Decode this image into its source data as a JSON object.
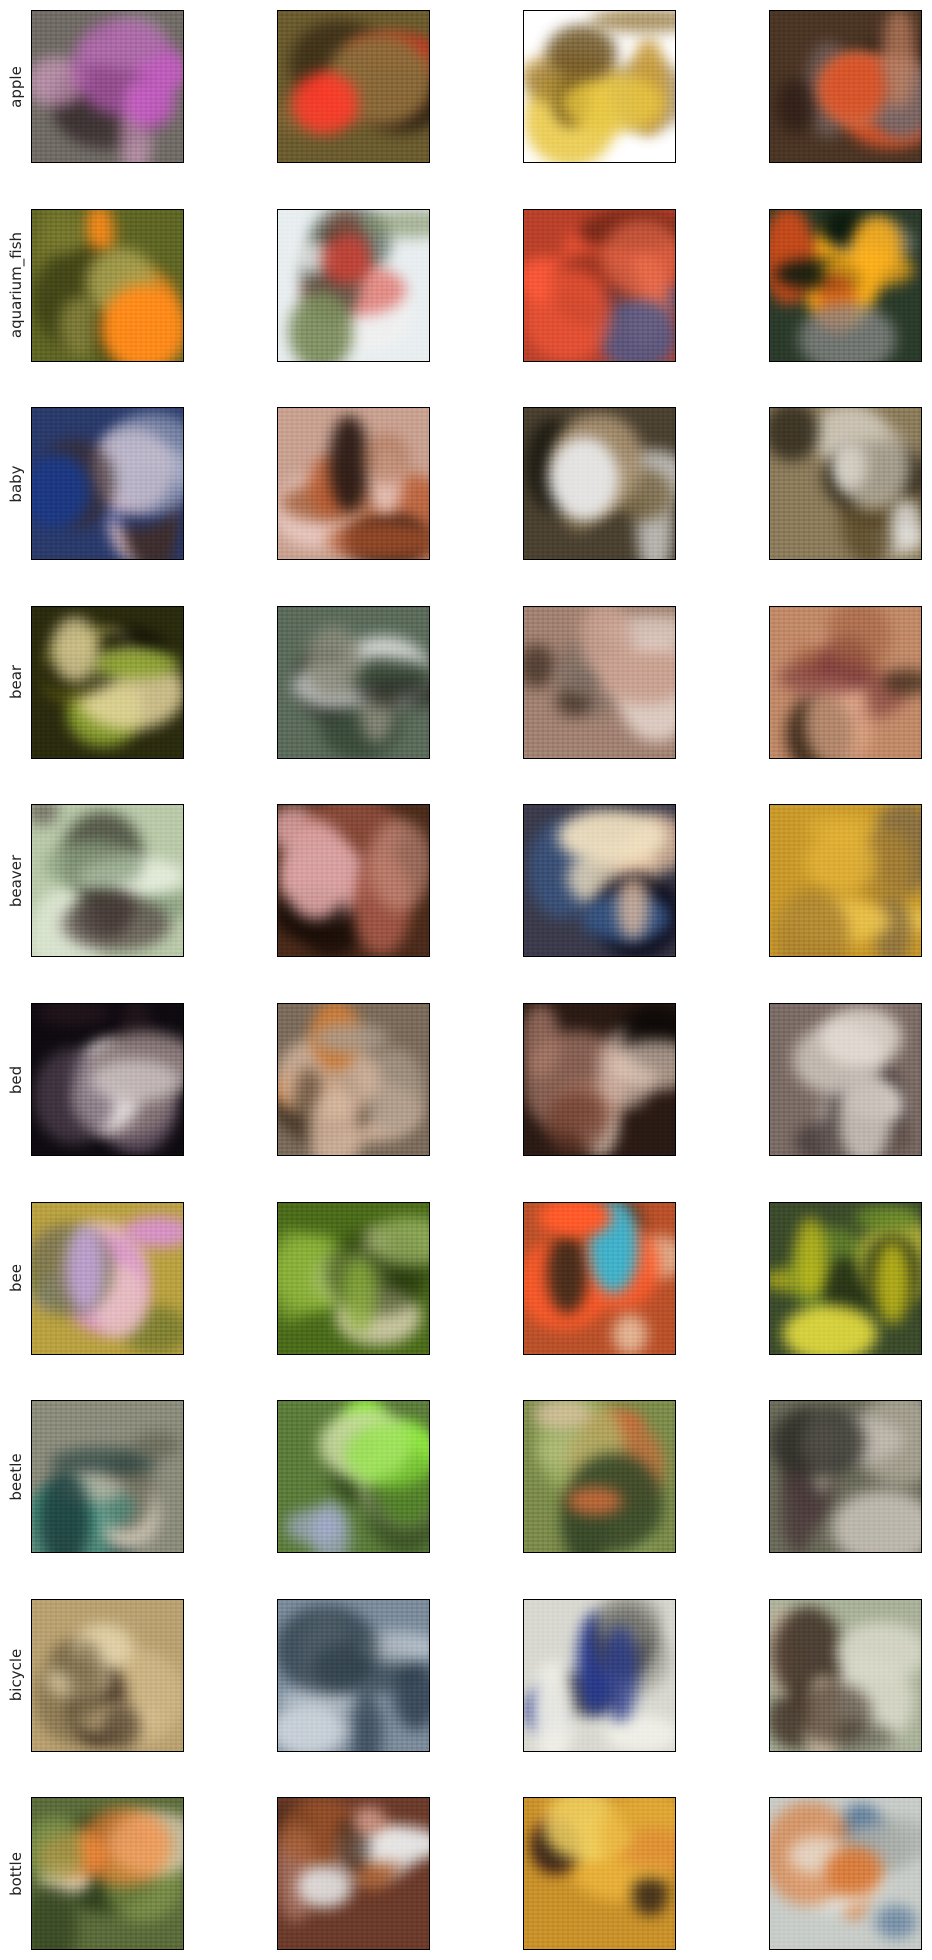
{
  "rows": [
    {
      "label": "apple",
      "tiles": [
        {
          "bg": "#6f6a64",
          "accents": [
            "#c25cc0",
            "#8a8883",
            "#3a2f30",
            "#d9a0c8"
          ]
        },
        {
          "bg": "#6a5a2e",
          "accents": [
            "#ff3b2a",
            "#d82a1a",
            "#2a1e10",
            "#8a6a3a"
          ]
        },
        {
          "bg": "#ffffff",
          "accents": [
            "#8a6a2a",
            "#c79a3a",
            "#e8c640",
            "#6a5020"
          ]
        },
        {
          "bg": "#4a3424",
          "accents": [
            "#d8542a",
            "#7a6a6a",
            "#2a1a14",
            "#c08060"
          ]
        }
      ]
    },
    {
      "label": "aquarium_fish",
      "tiles": [
        {
          "bg": "#5e6424",
          "accents": [
            "#ff8a1a",
            "#7a7a30",
            "#3a3e14",
            "#a8a050"
          ]
        },
        {
          "bg": "#e8eef0",
          "accents": [
            "#d8443a",
            "#2a3a2a",
            "#7a8a5a",
            "#f0f0f0"
          ]
        },
        {
          "bg": "#b8402a",
          "accents": [
            "#ff5a3a",
            "#7a2a1a",
            "#4a5a8a",
            "#e86a4a"
          ]
        },
        {
          "bg": "#2a3a2a",
          "accents": [
            "#ffb01a",
            "#c84a1a",
            "#8a8a8a",
            "#0a1a10"
          ]
        }
      ]
    },
    {
      "label": "baby",
      "tiles": [
        {
          "bg": "#2a3a6a",
          "accents": [
            "#1a3a8a",
            "#e8c8d0",
            "#a8b0c8",
            "#3a2a2a"
          ]
        },
        {
          "bg": "#c8a090",
          "accents": [
            "#b85a30",
            "#e8c8c0",
            "#2a1a14",
            "#a86a4a"
          ]
        },
        {
          "bg": "#4a4030",
          "accents": [
            "#e8e8e8",
            "#7a6a4a",
            "#1a1810",
            "#a89070"
          ]
        },
        {
          "bg": "#8a7a5a",
          "accents": [
            "#f0f0f0",
            "#5a4a2a",
            "#c8c0b0",
            "#2a2418"
          ]
        }
      ]
    },
    {
      "label": "bear",
      "tiles": [
        {
          "bg": "#2a2a0e",
          "accents": [
            "#e8d8a0",
            "#6a6a1a",
            "#0a0a04",
            "#8aa030"
          ]
        },
        {
          "bg": "#5a6a5a",
          "accents": [
            "#1a1a14",
            "#f0f0f0",
            "#3a4a3a",
            "#8a8a7a"
          ]
        },
        {
          "bg": "#a08070",
          "accents": [
            "#c8a090",
            "#3a2a20",
            "#7a6a60",
            "#e8d8d0"
          ]
        },
        {
          "bg": "#c08868",
          "accents": [
            "#7a3a3a",
            "#e8b090",
            "#3a2a1a",
            "#a06040"
          ]
        }
      ]
    },
    {
      "label": "beaver",
      "tiles": [
        {
          "bg": "#b8c8a8",
          "accents": [
            "#4a3a3a",
            "#e8f0e0",
            "#2a2a20",
            "#8aa080"
          ]
        },
        {
          "bg": "#4a2a1a",
          "accents": [
            "#d8a0a0",
            "#a85a4a",
            "#1a0e08",
            "#c89080"
          ]
        },
        {
          "bg": "#3a3a4a",
          "accents": [
            "#e8c0a0",
            "#0a0a1a",
            "#3a5a8a",
            "#f0e0c0"
          ]
        },
        {
          "bg": "#c8982a",
          "accents": [
            "#e8b83a",
            "#8a7040",
            "#f0c850",
            "#a88030"
          ]
        }
      ]
    },
    {
      "label": "bed",
      "tiles": [
        {
          "bg": "#0e0a10",
          "accents": [
            "#e8e0e0",
            "#5a4a5a",
            "#2a1a20",
            "#8a7a7a"
          ]
        },
        {
          "bg": "#7a6a5a",
          "accents": [
            "#d8b8a0",
            "#4a3a2a",
            "#c87a3a",
            "#a89888"
          ]
        },
        {
          "bg": "#2a1a14",
          "accents": [
            "#e8d0c0",
            "#6a3a2a",
            "#0e0a08",
            "#a87a6a"
          ]
        },
        {
          "bg": "#7a6a64",
          "accents": [
            "#c8c0b8",
            "#3a3030",
            "#e8e0d8",
            "#5a4a44"
          ]
        }
      ]
    },
    {
      "label": "bee",
      "tiles": [
        {
          "bg": "#b8a040",
          "accents": [
            "#d890d0",
            "#e8c0c0",
            "#5a6a2a",
            "#c8a8e8"
          ]
        },
        {
          "bg": "#4a6a1a",
          "accents": [
            "#8ab03a",
            "#d8d0b0",
            "#2a3a10",
            "#a8c070"
          ]
        },
        {
          "bg": "#b8502a",
          "accents": [
            "#ff5a2a",
            "#e8c0a0",
            "#3a2a1a",
            "#40b0c8"
          ]
        },
        {
          "bg": "#3a4a2a",
          "accents": [
            "#c8c01a",
            "#6a8a2a",
            "#1a2414",
            "#e8e040"
          ]
        }
      ]
    },
    {
      "label": "beetle",
      "tiles": [
        {
          "bg": "#8a8a7a",
          "accents": [
            "#1a3a3a",
            "#3a8a7a",
            "#c8c0b0",
            "#5a5a4a"
          ]
        },
        {
          "bg": "#5a7a3a",
          "accents": [
            "#8ae83a",
            "#a8b0d8",
            "#2a3a1a",
            "#c8d8a0"
          ]
        },
        {
          "bg": "#7a8a4a",
          "accents": [
            "#c86a3a",
            "#a8c070",
            "#3a4a2a",
            "#d8c0a0"
          ]
        },
        {
          "bg": "#6a6a5a",
          "accents": [
            "#2a2a24",
            "#c8c0b0",
            "#4a3a3a",
            "#e0d8d0"
          ]
        }
      ]
    },
    {
      "label": "bicycle",
      "tiles": [
        {
          "bg": "#b8a070",
          "accents": [
            "#7a6a4a",
            "#d8c090",
            "#4a3a2a",
            "#e8d8b0"
          ]
        },
        {
          "bg": "#7a8a9a",
          "accents": [
            "#c8d0d8",
            "#3a4a5a",
            "#a8b0b8",
            "#2a3a44"
          ]
        },
        {
          "bg": "#d8d8d0",
          "accents": [
            "#2a3a8a",
            "#4a4a4a",
            "#f0f0e8",
            "#8a8a80"
          ]
        },
        {
          "bg": "#a8b098",
          "accents": [
            "#3a2a20",
            "#d8d8c8",
            "#6a6a5a",
            "#c8b8a0"
          ]
        }
      ]
    },
    {
      "label": "bottle",
      "tiles": [
        {
          "bg": "#5a6a3a",
          "accents": [
            "#ff8a3a",
            "#2a3a1a",
            "#e8d8c0",
            "#8aa050"
          ]
        },
        {
          "bg": "#6a3a2a",
          "accents": [
            "#e8e8e8",
            "#a85a2a",
            "#2a1a14",
            "#c89080"
          ]
        },
        {
          "bg": "#c8902a",
          "accents": [
            "#e8b03a",
            "#c83a2a",
            "#3a2a1a",
            "#f0d060"
          ]
        },
        {
          "bg": "#c8ccc8",
          "accents": [
            "#d87a3a",
            "#e8ece8",
            "#a8aca8",
            "#5a7a9a"
          ]
        }
      ]
    }
  ]
}
